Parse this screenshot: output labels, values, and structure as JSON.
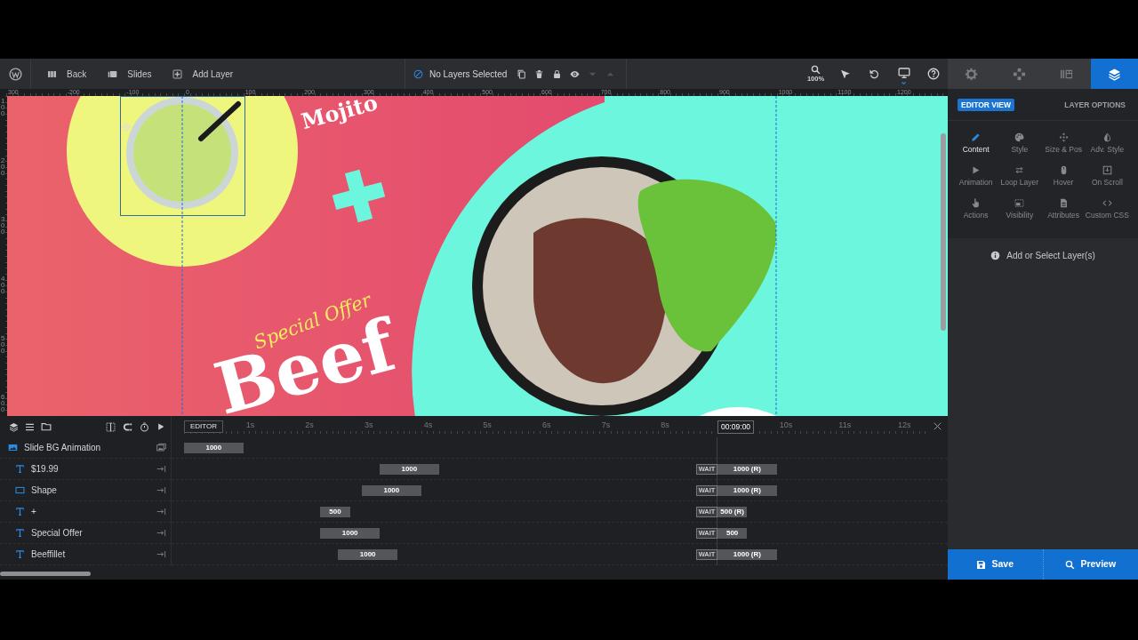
{
  "toolbar": {
    "buttons": [
      {
        "label": "Back"
      },
      {
        "label": "Slides"
      },
      {
        "label": "Add Layer"
      }
    ],
    "selection": "No Layers Selected",
    "layer_actions": [
      {
        "disabled": false
      },
      {
        "disabled": false
      },
      {
        "disabled": false
      },
      {
        "disabled": false
      },
      {
        "disabled": true
      },
      {
        "disabled": true
      }
    ],
    "zoom": "100%"
  },
  "panel_tabs": [
    {
      "selected": false
    },
    {
      "selected": false
    },
    {
      "selected": false
    },
    {
      "selected": true
    }
  ],
  "ruler": {
    "horizontal": [
      "300",
      "-200",
      "-100",
      "0",
      "100",
      "200",
      "300",
      "400",
      "500",
      "600",
      "700",
      "800",
      "900",
      "1000",
      "1100",
      "1200"
    ],
    "vertical": [
      "100",
      "200",
      "300",
      "400",
      "500",
      "600"
    ]
  },
  "slide": {
    "texts": [
      {
        "kind": "title",
        "text": "Mojito"
      },
      {
        "kind": "script",
        "text": "Special Offer"
      },
      {
        "kind": "headline",
        "text": "Beef"
      }
    ]
  },
  "timeline": {
    "editor": "EDITOR",
    "seconds": [
      "1s",
      "2s",
      "3s",
      "4s",
      "5s",
      "6s",
      "7s",
      "8s",
      "10s",
      "11s",
      "12s"
    ],
    "playhead": "00:09:00",
    "layers": [
      {
        "kind": "slide",
        "name": "Slide BG Animation",
        "in": "1000"
      },
      {
        "kind": "text",
        "name": "$19.99",
        "in": "1000",
        "wait": "WAIT",
        "out": "1000 (R)"
      },
      {
        "kind": "shape",
        "name": "Shape",
        "in": "1000",
        "wait": "WAIT",
        "out": "1000 (R)"
      },
      {
        "kind": "text",
        "name": "+",
        "in": "500",
        "wait": "WAIT",
        "out": "500 (R)"
      },
      {
        "kind": "text",
        "name": "Special Offer",
        "in": "1000",
        "wait": "WAIT",
        "out": "500"
      },
      {
        "kind": "text",
        "name": "Beeffillet",
        "in": "1000",
        "wait": "WAIT",
        "out": "1000 (R)"
      }
    ]
  },
  "layer_options": {
    "view_tabs": [
      {
        "label": "EDITOR VIEW",
        "selected": true
      },
      {
        "label": "LAYER OPTIONS",
        "selected": false
      }
    ],
    "options": [
      {
        "label": "Content",
        "selected": true
      },
      {
        "label": "Style",
        "selected": false
      },
      {
        "label": "Size & Pos",
        "selected": false
      },
      {
        "label": "Adv. Style",
        "selected": false
      },
      {
        "label": "Animation",
        "selected": false
      },
      {
        "label": "Loop Layer",
        "selected": false
      },
      {
        "label": "Hover",
        "selected": false
      },
      {
        "label": "On Scroll",
        "selected": false
      },
      {
        "label": "Actions",
        "selected": false
      },
      {
        "label": "Visibility",
        "selected": false
      },
      {
        "label": "Attributes",
        "selected": false
      },
      {
        "label": "Custom CSS",
        "selected": false
      }
    ],
    "hint": "Add or Select Layer(s)"
  },
  "actions": [
    {
      "label": "Save"
    },
    {
      "label": "Preview"
    }
  ]
}
